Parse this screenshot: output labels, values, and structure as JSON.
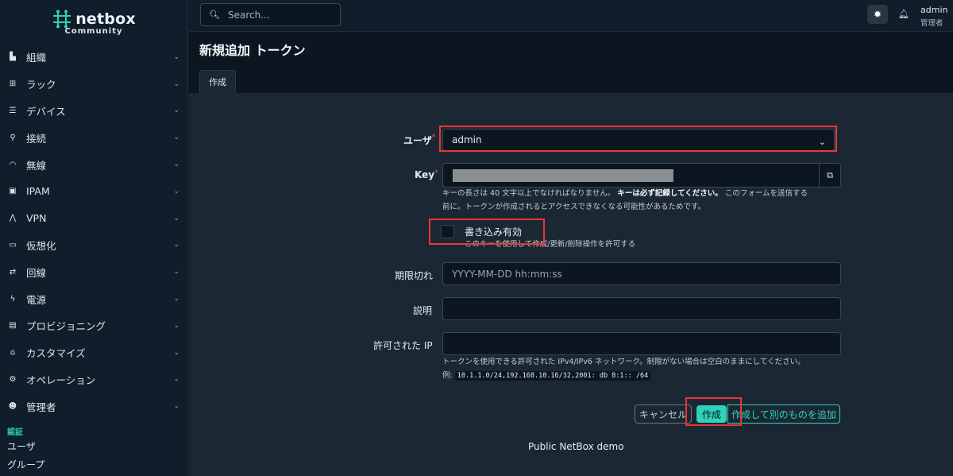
{
  "brand": {
    "name": "netbox",
    "edition": "Community"
  },
  "sidebar": {
    "items": [
      {
        "label": "組織",
        "icon": "domain-icon"
      },
      {
        "label": "ラック",
        "icon": "rack-icon"
      },
      {
        "label": "デバイス",
        "icon": "server-icon"
      },
      {
        "label": "接続",
        "icon": "connection-icon"
      },
      {
        "label": "無線",
        "icon": "wifi-icon"
      },
      {
        "label": "IPAM",
        "icon": "counter-icon"
      },
      {
        "label": "VPN",
        "icon": "vpn-icon"
      },
      {
        "label": "仮想化",
        "icon": "monitor-icon"
      },
      {
        "label": "回線",
        "icon": "circuit-icon"
      },
      {
        "label": "電源",
        "icon": "flash-icon"
      },
      {
        "label": "プロビジョニング",
        "icon": "file-icon"
      },
      {
        "label": "カスタマイズ",
        "icon": "toolbox-icon"
      },
      {
        "label": "オペレーション",
        "icon": "cogs-icon"
      },
      {
        "label": "管理者",
        "icon": "users-icon"
      }
    ],
    "section_title": "認証",
    "section_items": [
      "ユーザ",
      "グループ"
    ]
  },
  "topbar": {
    "search_placeholder": "Search...",
    "user_name": "admin",
    "user_role": "管理者"
  },
  "page": {
    "title": "新規追加 トークン",
    "tab": "作成"
  },
  "form": {
    "user_label": "ユーザ",
    "user_value": "admin",
    "key_label": "Key",
    "key_help_1": "キーの長さは 40 文字以上でなければなりません。",
    "key_help_bold": "キーは必ず記録してください。",
    "key_help_2": "このフォームを送信する",
    "key_help_3": "前に。トークンが作成されるとアクセスできなくなる可能性があるためです。",
    "write_label": "書き込み有効",
    "write_help": "このキーを使用して作成/更新/削除操作を許可する",
    "expires_label": "期限切れ",
    "expires_placeholder": "YYYY-MM-DD hh:mm:ss",
    "description_label": "説明",
    "allowed_ips_label": "許可された IP",
    "allowed_ips_help": "トークンを使用できる許可された IPv4/IPv6 ネットワーク。制限がない場合は空白のままにしてください。",
    "example_prefix": "例:",
    "example_code": "10.1.1.0/24,192.168.10.16/32,2001: db 8:1:: /64"
  },
  "buttons": {
    "cancel": "キャンセル",
    "create": "作成",
    "create_and_add": "作成して別のものを追加"
  },
  "footer": "Public NetBox demo",
  "colors": {
    "accent": "#2fd1b8",
    "highlight": "#e53935",
    "background": "#0b1620"
  }
}
